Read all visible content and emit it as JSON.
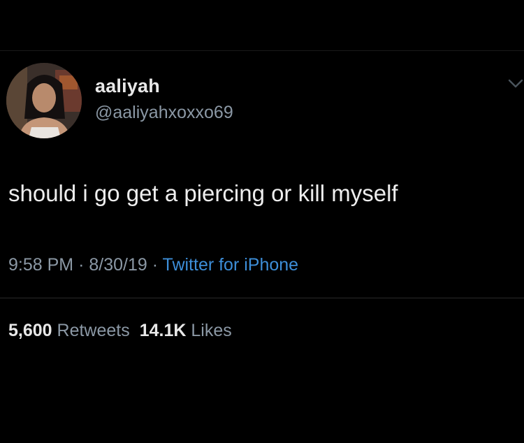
{
  "colors": {
    "background": "#000000",
    "primary_text": "#e7e9ea",
    "secondary_text": "#8b98a5",
    "link": "#3d8ed8"
  },
  "tweet": {
    "author": {
      "display_name": "aaliyah",
      "handle": "@aaliyahxoxxo69",
      "avatar_icon": "profile-photo"
    },
    "text": "should i go get a piercing or kill myself",
    "time": "9:58 PM",
    "date": "8/30/19",
    "separator": "·",
    "source": "Twitter for iPhone",
    "retweets_count": "5,600",
    "retweets_label": "Retweets",
    "likes_count": "14.1K",
    "likes_label": "Likes",
    "menu_icon": "chevron-down-icon"
  }
}
